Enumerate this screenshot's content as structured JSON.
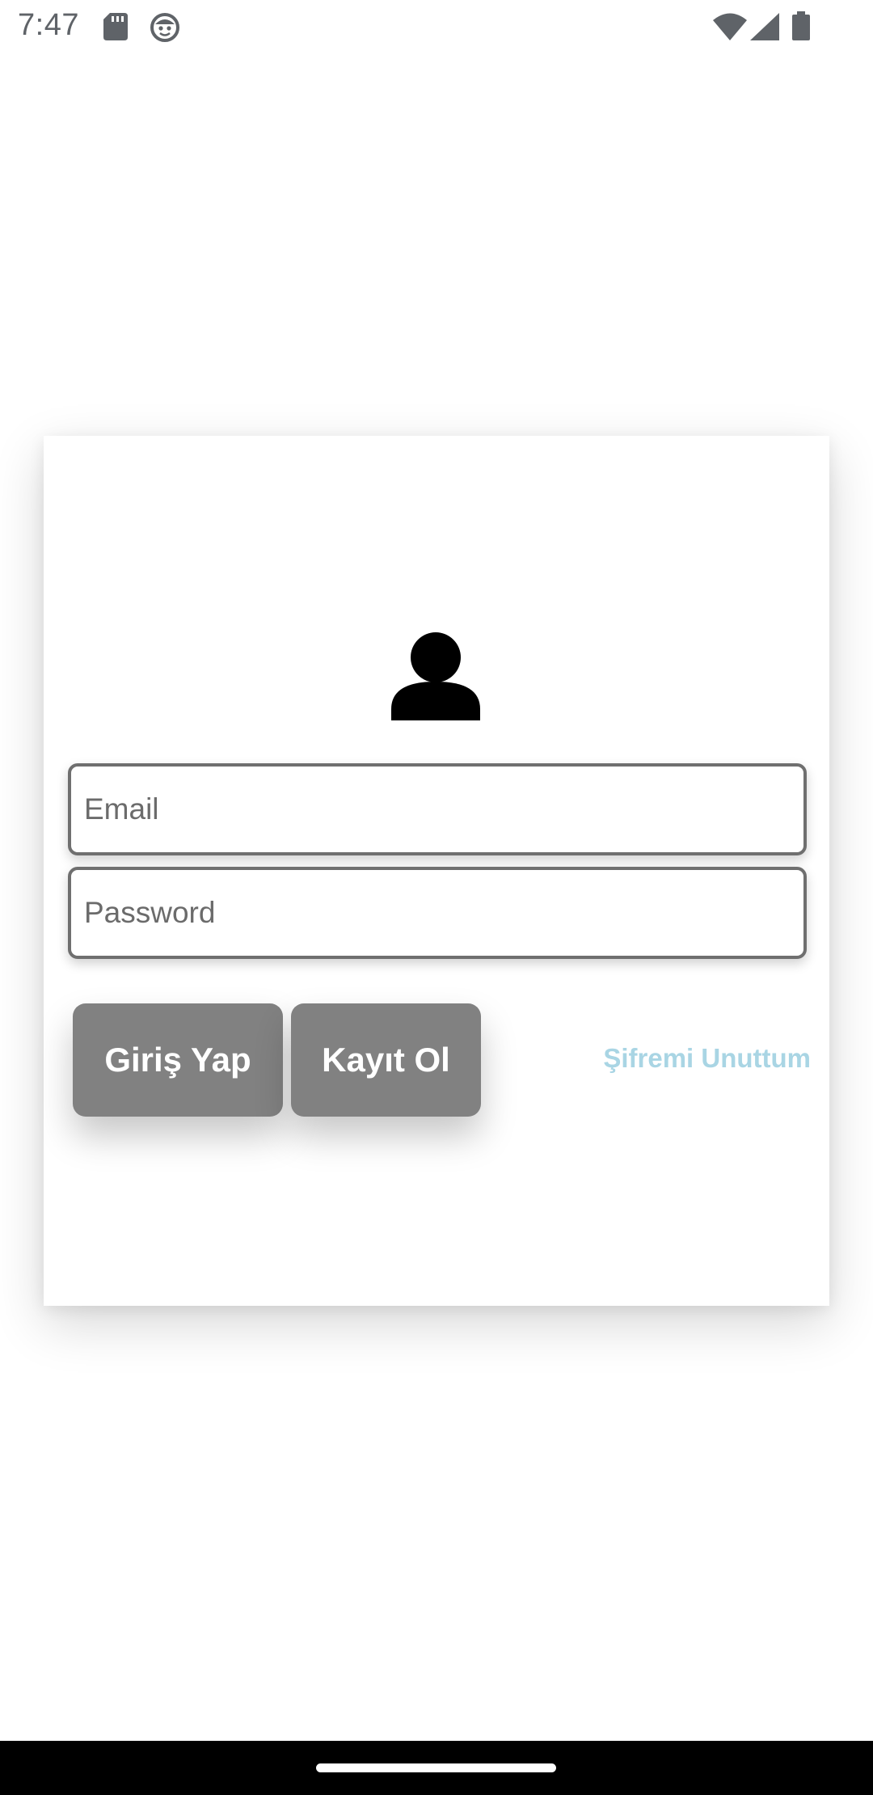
{
  "status_bar": {
    "time": "7:47",
    "icons": [
      "sd-card-icon",
      "face-icon",
      "wifi-icon",
      "signal-icon",
      "battery-icon"
    ]
  },
  "login_card": {
    "avatar_icon": "person-icon",
    "email": {
      "placeholder": "Email",
      "value": ""
    },
    "password": {
      "placeholder": "Password",
      "value": ""
    },
    "login_button_label": "Giriş Yap",
    "register_button_label": "Kayıt Ol",
    "forgot_password_label": "Şifremi Unuttum"
  },
  "colors": {
    "button_background": "#818181",
    "button_text": "#ffffff",
    "link": "#a9d5e4",
    "field_border": "#6f6f6f",
    "nav_bar": "#000000"
  }
}
